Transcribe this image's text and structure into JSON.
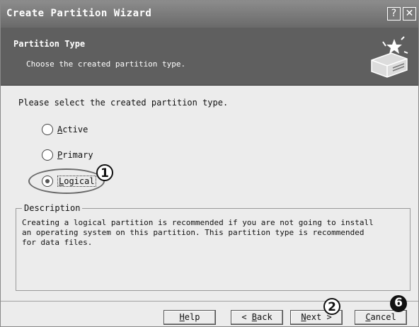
{
  "window": {
    "title": "Create Partition Wizard",
    "help_glyph": "?",
    "close_glyph": "✕"
  },
  "header": {
    "title": "Partition Type",
    "subtitle": "Choose the created partition type.",
    "icon": "wizard-disk-icon"
  },
  "body": {
    "prompt": "Please select the created partition type.",
    "options": [
      {
        "first": "A",
        "rest": "ctive",
        "selected": false
      },
      {
        "first": "P",
        "rest": "rimary",
        "selected": false
      },
      {
        "first": "L",
        "rest": "ogical",
        "selected": true
      }
    ]
  },
  "description": {
    "legend": "Description",
    "text": "Creating a logical partition is recommended if you are not going to install\nan operating system on this partition. This partition type is recommended\nfor data files."
  },
  "buttons": {
    "help": {
      "first": "H",
      "rest": "elp"
    },
    "back": {
      "prefix": "< ",
      "first": "B",
      "rest": "ack"
    },
    "next": {
      "first": "N",
      "rest": "ext >"
    },
    "cancel": {
      "first": "C",
      "rest": "ancel"
    }
  },
  "callouts": {
    "one": "1",
    "two": "2",
    "six": "6"
  }
}
